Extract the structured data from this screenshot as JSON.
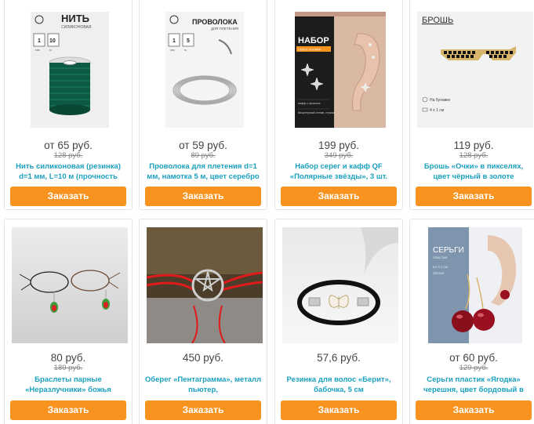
{
  "order_label": "Заказать",
  "products": [
    {
      "price": "от 65 руб.",
      "old_price": "128 руб.",
      "title": "Нить силиконовая (резинка) d=1 мм, L=10 м (прочность",
      "image": {
        "heading": "НИТЬ",
        "sub": "СИЛИКОНОВАЯ",
        "size1": "1",
        "unit1": "мм",
        "size2": "10",
        "unit2": "м"
      }
    },
    {
      "price": "от 59 руб.",
      "old_price": "89 руб.",
      "title": "Проволока для плетения d=1 мм, намотка 5 м, цвет серебро",
      "image": {
        "heading": "ПРОВОЛОКА",
        "sub": "ДЛЯ ПЛЕТЕНИЯ",
        "size1": "1",
        "unit1": "мм",
        "size2": "5",
        "unit2": "м"
      }
    },
    {
      "price": "199 руб.",
      "old_price": "349 руб.",
      "title": "Набор серег и кафф QF «Полярные звёзды», 3 шт.",
      "image": {
        "heading": "НАБОР",
        "sub": "СЕРЕГ И КАФФ",
        "note1": "кафф с прокола",
        "note2": "бижутерный сплав, стразы"
      }
    },
    {
      "price": "119 руб.",
      "old_price": "128 руб.",
      "title": "Брошь «Очки» в пикселях, цвет чёрный в золоте",
      "image": {
        "heading": "БРОШЬ",
        "note1": "На булавке",
        "note2": "4 х 1 см"
      }
    },
    {
      "price": "80 руб.",
      "old_price": "189 руб.",
      "title": "Браслеты парные «Неразлучники» божья",
      "image": {}
    },
    {
      "price": "450 руб.",
      "old_price": "",
      "title": "Оберег «Пентаграмма», металл пьютер,",
      "image": {}
    },
    {
      "price": "57,6 руб.",
      "old_price": "",
      "title": "Резинка для волос «Берит», бабочка, 5 см",
      "image": {}
    },
    {
      "price": "от 60 руб.",
      "old_price": "129 руб.",
      "title": "Серьги пластик «Ягодка» черешня, цвет бордовый в",
      "image": {
        "heading": "СЕРЬГИ",
        "sub": "ПЛАСТИК",
        "note1": "6,5 Х 2 СМ",
        "note2": "ЛЁГКИЕ"
      }
    }
  ],
  "colors": {
    "accent": "#f7931e",
    "link": "#1aa0c0"
  }
}
